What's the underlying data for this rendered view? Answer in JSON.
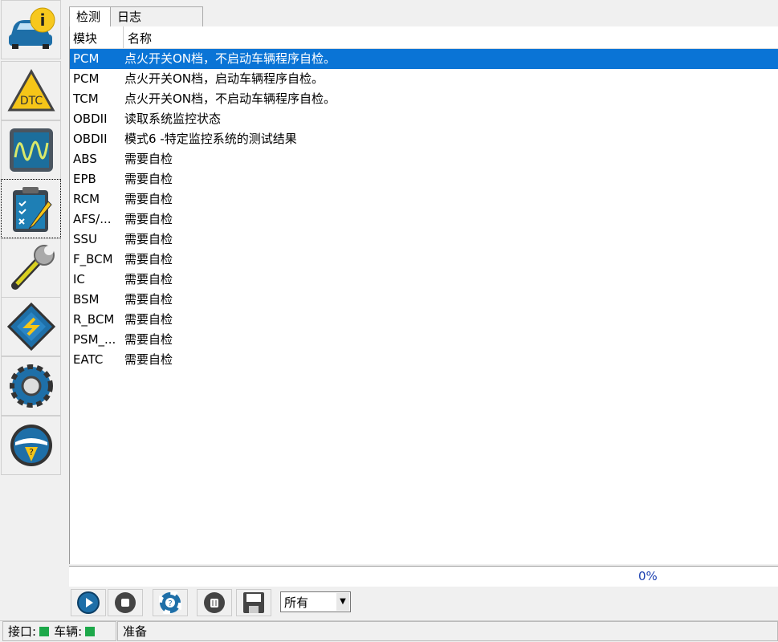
{
  "sidebar": {
    "items": [
      {
        "icon": "vehicle-info-icon"
      },
      {
        "icon": "dtc-warning-icon",
        "label": "DTC"
      },
      {
        "icon": "oscilloscope-icon"
      },
      {
        "icon": "checklist-icon"
      },
      {
        "icon": "wrench-icon"
      },
      {
        "icon": "chip-icon"
      },
      {
        "icon": "gear-icon"
      },
      {
        "icon": "steering-help-icon"
      }
    ]
  },
  "tabs": [
    "检测",
    "日志"
  ],
  "columns": [
    "模块",
    "名称"
  ],
  "rows": [
    [
      "PCM",
      "点火开关ON档，不启动车辆程序自检。"
    ],
    [
      "PCM",
      "点火开关ON档，启动车辆程序自检。"
    ],
    [
      "TCM",
      "点火开关ON档，不启动车辆程序自检。"
    ],
    [
      "OBDII",
      "读取系统监控状态"
    ],
    [
      "OBDII",
      "模式6 -特定监控系统的测试结果"
    ],
    [
      "ABS",
      "需要自检"
    ],
    [
      "EPB",
      "需要自检"
    ],
    [
      "RCM",
      "需要自检"
    ],
    [
      "AFS/...",
      "需要自检"
    ],
    [
      "SSU",
      "需要自检"
    ],
    [
      "F_BCM",
      "需要自检"
    ],
    [
      "IC",
      "需要自检"
    ],
    [
      "BSM",
      "需要自检"
    ],
    [
      "R_BCM",
      "需要自检"
    ],
    [
      "PSM_...",
      "需要自检"
    ],
    [
      "EATC",
      "需要自检"
    ]
  ],
  "progress": "0%",
  "filter": "所有",
  "status": {
    "port": "接口:",
    "vehicle": "车辆:",
    "message": "准备"
  }
}
